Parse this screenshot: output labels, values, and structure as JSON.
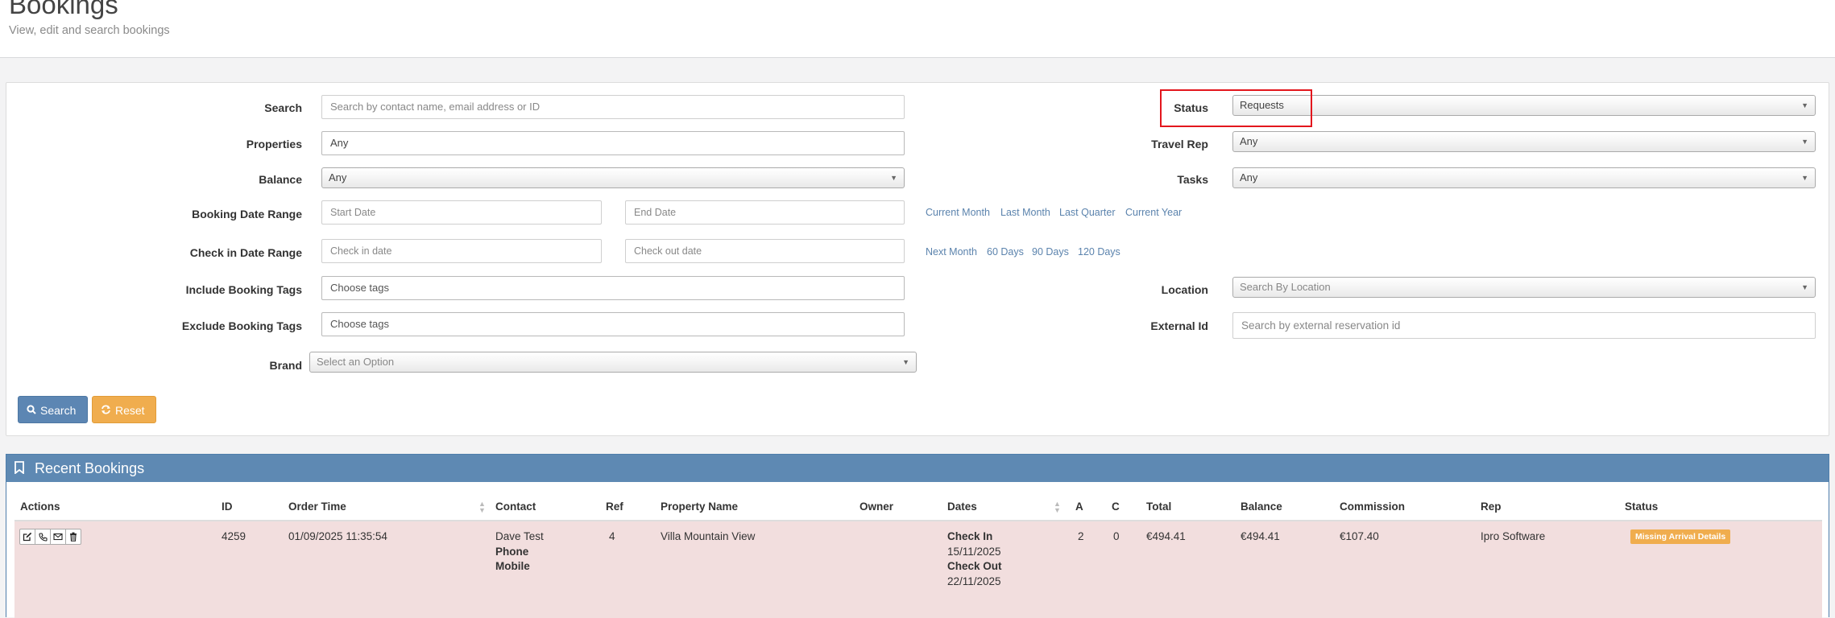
{
  "header": {
    "title": "Bookings",
    "subtitle": "View, edit and search bookings"
  },
  "filters": {
    "search": {
      "label": "Search",
      "placeholder": "Search by contact name, email address or ID"
    },
    "properties": {
      "label": "Properties",
      "value": "Any"
    },
    "balance": {
      "label": "Balance",
      "value": "Any"
    },
    "booking_date_range": {
      "label": "Booking Date Range",
      "start_placeholder": "Start Date",
      "end_placeholder": "End Date",
      "quick": [
        "Current Month",
        "Last Month",
        "Last Quarter",
        "Current Year"
      ]
    },
    "check_in_date_range": {
      "label": "Check in Date Range",
      "start_placeholder": "Check in date",
      "end_placeholder": "Check out date",
      "quick": [
        "Next Month",
        "60 Days",
        "90 Days",
        "120 Days"
      ]
    },
    "include_tags": {
      "label": "Include Booking Tags",
      "placeholder": "Choose tags"
    },
    "exclude_tags": {
      "label": "Exclude Booking Tags",
      "placeholder": "Choose tags"
    },
    "brand": {
      "label": "Brand",
      "placeholder": "Select an Option"
    },
    "status": {
      "label": "Status",
      "value": "Requests"
    },
    "travel_rep": {
      "label": "Travel Rep",
      "value": "Any"
    },
    "tasks": {
      "label": "Tasks",
      "value": "Any"
    },
    "location": {
      "label": "Location",
      "placeholder": "Search By Location"
    },
    "external_id": {
      "label": "External Id",
      "placeholder": "Search by external reservation id"
    }
  },
  "buttons": {
    "search": "Search",
    "reset": "Reset"
  },
  "recent": {
    "title": "Recent Bookings",
    "columns": [
      "Actions",
      "ID",
      "Order Time",
      "Contact",
      "Ref",
      "Property Name",
      "Owner",
      "Dates",
      "A",
      "C",
      "Total",
      "Balance",
      "Commission",
      "Rep",
      "Status"
    ],
    "rows": [
      {
        "id": "4259",
        "order_time": "01/09/2025 11:35:54",
        "contact_name": "Dave Test",
        "contact_phone_label": "Phone",
        "contact_mobile_label": "Mobile",
        "ref": "4",
        "property_name": "Villa Mountain View",
        "owner": "",
        "check_in_label": "Check In",
        "check_in": "15/11/2025",
        "check_out_label": "Check Out",
        "check_out": "22/11/2025",
        "adults": "2",
        "children": "0",
        "total": "€494.41",
        "balance": "€494.41",
        "commission": "€107.40",
        "rep": "Ipro Software",
        "status": "Missing Arrival Details"
      }
    ]
  },
  "colors": {
    "accent": "#5e89b3",
    "reset": "#f0ad4e",
    "row_danger": "#f2dede",
    "highlight": "#e3161d"
  }
}
